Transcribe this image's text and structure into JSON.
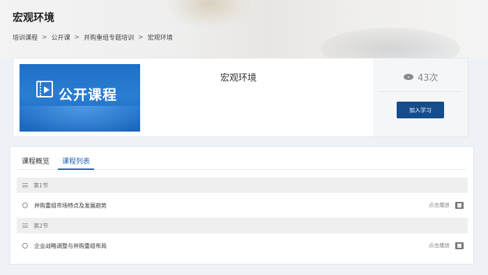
{
  "header": {
    "title": "宏观环境",
    "breadcrumb": [
      "培训课程",
      "公开课",
      "并购重组专题培训",
      "宏观环境"
    ],
    "separator": ">"
  },
  "course": {
    "thumbnail_text": "公开课程",
    "name": "宏观环境",
    "views": "43次",
    "join_label": "加入学习",
    "accent_color": "#154c8c"
  },
  "tabs": [
    {
      "label": "课程概览",
      "active": false
    },
    {
      "label": "课程列表",
      "active": true
    }
  ],
  "sections": [
    {
      "title": "第1节",
      "lesson": "并购重组市场特点及发展趋势",
      "action": "点击播放"
    },
    {
      "title": "第2节",
      "lesson": "企业战略调整与并购重组布局",
      "action": "点击播放"
    }
  ],
  "icons": [
    "eye-icon",
    "film-icon",
    "menu-icon",
    "radio-circle-icon",
    "video-play-icon"
  ]
}
